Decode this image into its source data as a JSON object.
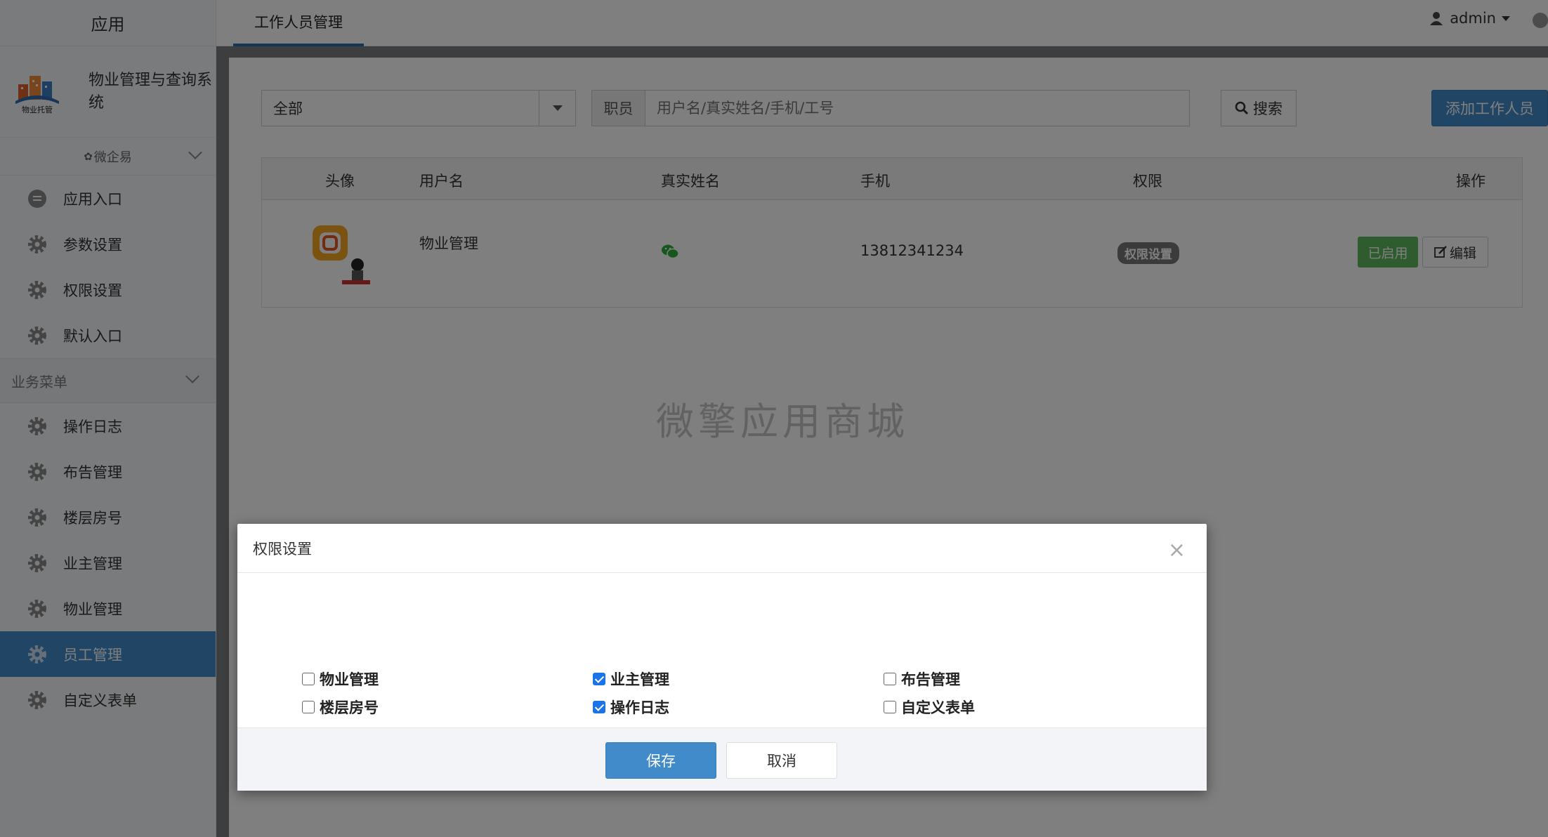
{
  "sidebar": {
    "header": "应用",
    "brand_name": "物业管理与查询系统",
    "logo_text": "物业托管",
    "platform_label": "微企易",
    "top_items": [
      {
        "label": "应用入口",
        "icon": "chat-bubble-icon"
      },
      {
        "label": "参数设置",
        "icon": "gear-icon"
      },
      {
        "label": "权限设置",
        "icon": "gear-icon"
      },
      {
        "label": "默认入口",
        "icon": "gear-icon"
      }
    ],
    "section_title": "业务菜单",
    "menu_items": [
      {
        "label": "操作日志",
        "icon": "gear-icon"
      },
      {
        "label": "布告管理",
        "icon": "gear-icon"
      },
      {
        "label": "楼层房号",
        "icon": "gear-icon"
      },
      {
        "label": "业主管理",
        "icon": "gear-icon"
      },
      {
        "label": "物业管理",
        "icon": "gear-icon"
      },
      {
        "label": "员工管理",
        "icon": "gear-icon",
        "active": true
      },
      {
        "label": "自定义表单",
        "icon": "gear-icon"
      }
    ]
  },
  "topbar": {
    "tab_label": "工作人员管理",
    "user_name": "admin"
  },
  "toolbar": {
    "filter_value": "全部",
    "search_addon": "职员",
    "search_placeholder": "用户名/真实姓名/手机/工号",
    "search_button": "搜索",
    "add_button": "添加工作人员"
  },
  "table": {
    "headers": [
      "头像",
      "用户名",
      "真实姓名",
      "手机",
      "权限",
      "操作"
    ],
    "rows": [
      {
        "username": "物业管理",
        "realname_icon": "wechat-icon",
        "phone": "13812341234",
        "permission_badge": "权限设置",
        "status_button": "已启用",
        "edit_button": "编辑"
      }
    ]
  },
  "watermark": "微擎应用商城",
  "modal": {
    "title": "权限设置",
    "options": [
      {
        "label": "物业管理",
        "checked": false
      },
      {
        "label": "业主管理",
        "checked": true
      },
      {
        "label": "布告管理",
        "checked": false
      },
      {
        "label": "楼层房号",
        "checked": false
      },
      {
        "label": "操作日志",
        "checked": true
      },
      {
        "label": "自定义表单",
        "checked": false
      }
    ],
    "save_button": "保存",
    "cancel_button": "取消"
  },
  "colors": {
    "primary": "#428bca",
    "success": "#5cb85c",
    "badge": "#777777",
    "checkbox": "#1a73e8"
  }
}
